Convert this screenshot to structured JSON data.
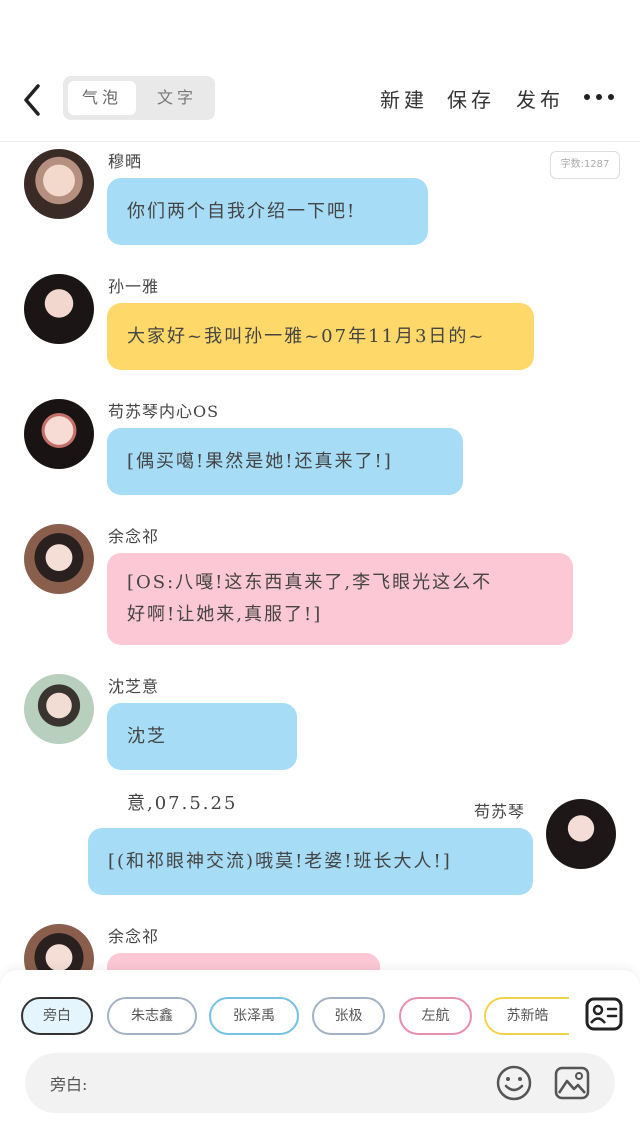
{
  "header": {
    "tabs": [
      "气泡",
      "文字"
    ],
    "actions": {
      "new": "新建",
      "save": "保存",
      "publish": "发布"
    }
  },
  "word_count": "字数:1287",
  "messages": [
    {
      "name": "穆晒",
      "text": "你们两个自我介绍一下吧!",
      "color": "#a6dcf6",
      "side": "left"
    },
    {
      "name": "孙一雅",
      "text": "大家好~我叫孙一雅~07年11月3日的~",
      "color": "#fed96a",
      "side": "left"
    },
    {
      "name": "苟苏琴内心OS",
      "text": "[偶买噶!果然是她!还真来了!]",
      "color": "#a6dcf6",
      "side": "left"
    },
    {
      "name": "余念祁",
      "text_line1": "[OS:八嘎!这东西真来了,李飞眼光这么不",
      "text_line2": "好啊!让她来,真服了!]",
      "color": "#fdc8d6",
      "side": "left"
    },
    {
      "name": "沈芝意",
      "text": "沈芝意,07.5.25",
      "color": "#a6dcf6",
      "side": "left"
    },
    {
      "name": "苟苏琴",
      "text": "[(和祁眼神交流)哦莫!老婆!班长大人!]",
      "color": "#a6dcf6",
      "side": "right"
    },
    {
      "name": "余念祁",
      "text": "",
      "color": "#fdc8d6",
      "side": "left"
    }
  ],
  "roles": [
    {
      "label": "旁白",
      "color": "#333333",
      "selected": true
    },
    {
      "label": "朱志鑫",
      "color": "#a3b2c4"
    },
    {
      "label": "张泽禹",
      "color": "#74c1e3"
    },
    {
      "label": "张极",
      "color": "#a3b2c4"
    },
    {
      "label": "左航",
      "color": "#ea8fab"
    },
    {
      "label": "苏新皓",
      "color": "#f2d24a"
    }
  ],
  "input": {
    "label": "旁白:"
  },
  "icons": {
    "back": "back-arrow-icon",
    "more": "more-dots-icon",
    "contacts": "contacts-card-icon",
    "emoji": "emoji-icon",
    "image": "image-icon"
  }
}
